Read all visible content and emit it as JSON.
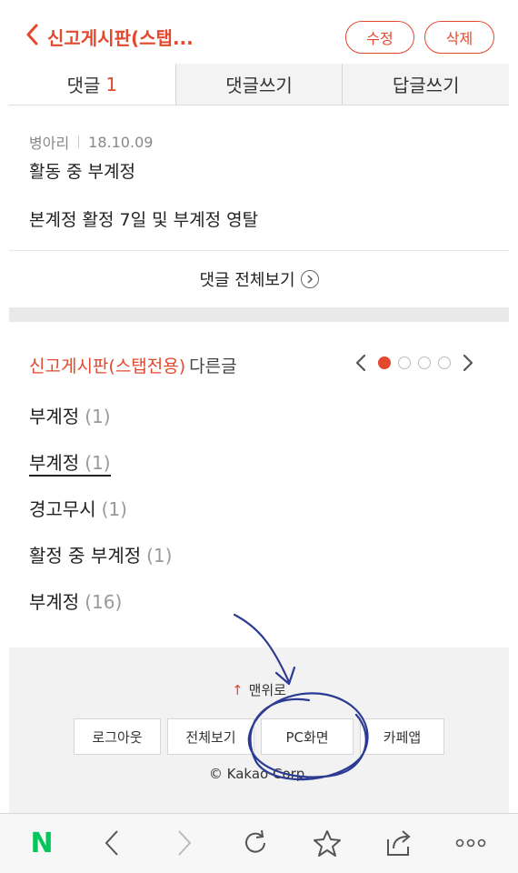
{
  "header": {
    "title": "신고게시판(스탭...",
    "edit_label": "수정",
    "delete_label": "삭제"
  },
  "tabs": [
    {
      "label": "댓글",
      "count": "1"
    },
    {
      "label": "댓글쓰기"
    },
    {
      "label": "답글쓰기"
    }
  ],
  "comment": {
    "author": "병아리",
    "date": "18.10.09",
    "line1": "활동 중 부계정",
    "line2": "본계정 활정 7일 및 부계정 영탈"
  },
  "view_all_label": "댓글 전체보기",
  "other_posts": {
    "board_name": "신고게시판(스탭전용)",
    "suffix": "다른글",
    "pager": {
      "pages": 4,
      "current": 1
    },
    "items": [
      {
        "title": "부계정",
        "count": "(1)"
      },
      {
        "title": "부계정",
        "count": "(1)"
      },
      {
        "title": "경고무시",
        "count": "(1)"
      },
      {
        "title": "활정 중 부계정",
        "count": "(1)"
      },
      {
        "title": "부계정",
        "count": "(16)"
      }
    ]
  },
  "footer": {
    "to_top": "맨위로",
    "buttons": [
      "로그아웃",
      "전체보기",
      "PC화면",
      "카페앱"
    ],
    "copyright": "© Kakao Corp."
  },
  "browser_bar": {
    "icons": [
      "naver-logo-icon",
      "back-icon",
      "forward-icon",
      "reload-icon",
      "bookmark-star-icon",
      "share-icon",
      "more-icon"
    ],
    "logo_letter": "N"
  },
  "colors": {
    "accent": "#e2492f",
    "naver_green": "#03c75a",
    "annotation_blue": "#2b3a93"
  }
}
